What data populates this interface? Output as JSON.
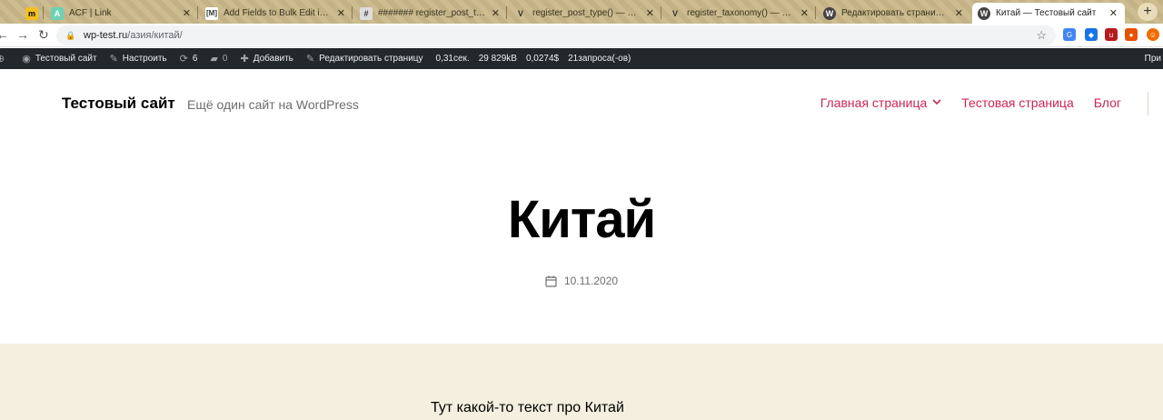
{
  "browser": {
    "tabs": [
      {
        "title": "",
        "fav": "m",
        "fav_color": "#f4c01e"
      },
      {
        "title": "ACF | Link",
        "fav": "A",
        "fav_color": "#6ed3b3"
      },
      {
        "title": "Add Fields to Bulk Edit in Word",
        "fav": "[M]",
        "fav_color": "#333333"
      },
      {
        "title": "####### register_post_type( :",
        "fav": "#",
        "fav_color": "#555555"
      },
      {
        "title": "register_post_type() — Создаё",
        "fav": "V",
        "fav_color": "#555555"
      },
      {
        "title": "register_taxonomy() — Добавл",
        "fav": "V",
        "fav_color": "#555555"
      },
      {
        "title": "Редактировать страницу ‹ Тест",
        "fav": "W",
        "fav_color": "#464342"
      },
      {
        "title": "Китай — Тестовый сайт",
        "fav": "W",
        "fav_color": "#464342"
      }
    ],
    "new_tab": "+",
    "url_host": "wp-test.ru",
    "url_path": "/азия/китай/"
  },
  "adminbar": {
    "site": "Тестовый сайт",
    "customize": "Настроить",
    "updates": "6",
    "comments": "0",
    "add": "Добавить",
    "edit": "Редактировать страницу",
    "time": "0,31сек.",
    "memory": "29 829kB",
    "cost": "0,0274$",
    "queries": "21запроса(-ов)",
    "right": "При"
  },
  "header": {
    "site_title": "Тестовый сайт",
    "site_description": "Ещё один сайт на WordPress",
    "menu": [
      "Главная страница",
      "Тестовая страница",
      "Блог"
    ]
  },
  "entry": {
    "title": "Китай",
    "date": "10.11.2020",
    "text": "Тут какой-то текст про Китай"
  },
  "colors": {
    "accent": "#cd2653",
    "content_bg": "#f5efe0",
    "adminbar_bg": "#23282d"
  }
}
